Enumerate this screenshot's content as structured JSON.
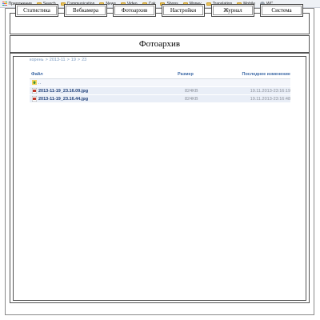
{
  "bookmarks": {
    "apps_label": "Приложения",
    "items": [
      {
        "label": "Search"
      },
      {
        "label": "Communication"
      },
      {
        "label": "News"
      },
      {
        "label": "Video"
      },
      {
        "label": "Cak"
      },
      {
        "label": "Shops"
      },
      {
        "label": "Money"
      },
      {
        "label": "Translation"
      },
      {
        "label": "Mobile"
      },
      {
        "label": "WC"
      }
    ]
  },
  "nav": {
    "buttons": [
      "Статистика",
      "Вебкамера",
      "Фотоархив",
      "Настройки",
      "Журнал",
      "Система"
    ]
  },
  "page": {
    "title": "Фотоархив"
  },
  "breadcrumb": {
    "parts": [
      "корень",
      ">",
      "2013-11",
      ">",
      "19",
      ">",
      "23"
    ]
  },
  "listing": {
    "headers": {
      "name": "Файл",
      "size": "Размер",
      "modified": "Последнее изменение"
    },
    "up_label": "..",
    "rows": [
      {
        "name": "2013-11-19_23.16.09.jpg",
        "size": "824KB",
        "modified": "19.11.2013-23:16:19"
      },
      {
        "name": "2013-11-19_23.16.44.jpg",
        "size": "824KB",
        "modified": "19.11.2013-23:16:48"
      }
    ]
  },
  "colors": {
    "link": "#3e6aa6",
    "breadcrumb": "#7f9ec4",
    "row_alt": "#e9eef7"
  }
}
